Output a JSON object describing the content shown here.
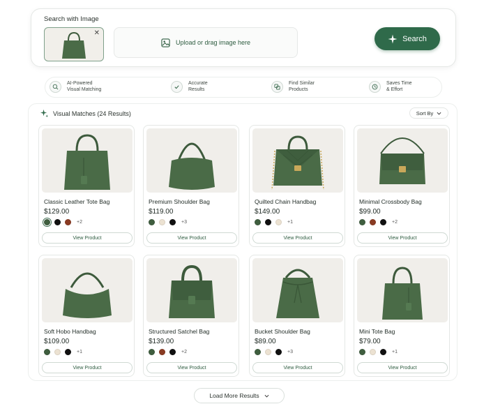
{
  "search": {
    "title": "Search with Image",
    "upload_text": "Upload or drag image here",
    "button_label": "Search"
  },
  "features": [
    {
      "line1": "AI-Powered",
      "line2": "Visual Matching",
      "icon": "sparkle-search-icon"
    },
    {
      "line1": "Accurate",
      "line2": "Results",
      "icon": "check-badge-icon"
    },
    {
      "line1": "Find Similar",
      "line2": "Products",
      "icon": "similar-products-icon"
    },
    {
      "line1": "Saves Time",
      "line2": "& Effort",
      "icon": "clock-icon"
    }
  ],
  "results": {
    "heading": "Visual Matches (24 Results)",
    "sort_label": "Sort By",
    "view_label": "View Product",
    "load_more": "Load More Results"
  },
  "products": [
    {
      "name": "Classic Leather Tote Bag",
      "price": "$129.00",
      "swatches": [
        "#3f5e3f",
        "#111111",
        "#8a3b23"
      ],
      "selected_swatch": 0,
      "more": "+2"
    },
    {
      "name": "Premium Shoulder Bag",
      "price": "$119.00",
      "swatches": [
        "#3f5e3f",
        "#ece2d2",
        "#111111"
      ],
      "more": "+3"
    },
    {
      "name": "Quilted Chain Handbag",
      "price": "$149.00",
      "swatches": [
        "#3f5e3f",
        "#111111",
        "#ece2d2"
      ],
      "more": "+1"
    },
    {
      "name": "Minimal Crossbody Bag",
      "price": "$99.00",
      "swatches": [
        "#3f5e3f",
        "#8a3b23",
        "#111111"
      ],
      "more": "+2"
    },
    {
      "name": "Soft Hobo Handbag",
      "price": "$109.00",
      "swatches": [
        "#3f5e3f",
        "#ece2d2",
        "#111111"
      ],
      "more": "+1"
    },
    {
      "name": "Structured Satchel Bag",
      "price": "$139.00",
      "swatches": [
        "#3f5e3f",
        "#8a3b23",
        "#111111"
      ],
      "more": "+2"
    },
    {
      "name": "Bucket Shoulder Bag",
      "price": "$89.00",
      "swatches": [
        "#3f5e3f",
        "#ece2d2",
        "#111111"
      ],
      "more": "+3"
    },
    {
      "name": "Mini Tote Bag",
      "price": "$79.00",
      "swatches": [
        "#3f5e3f",
        "#ece2d2",
        "#111111"
      ],
      "more": "+1"
    }
  ],
  "colors": {
    "accent": "#2f6a4a",
    "bag": "#4a6b47"
  }
}
